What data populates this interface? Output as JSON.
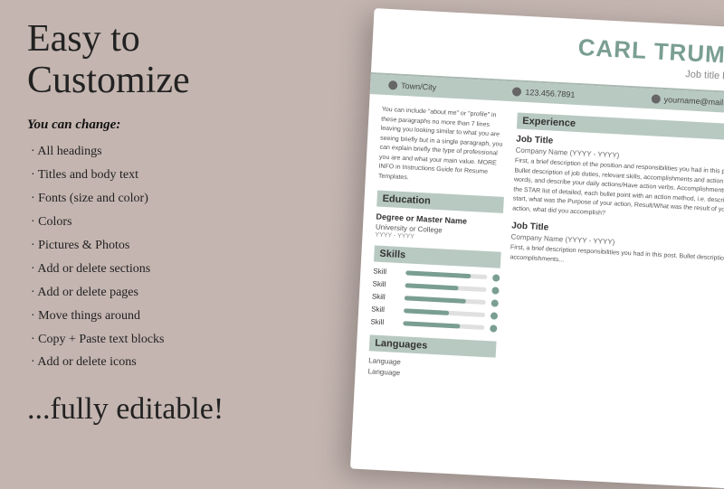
{
  "left": {
    "main_title": "Easy to Customize",
    "you_can_change_label": "You can change:",
    "features": [
      "All headings",
      "Titles and body text",
      "Fonts (size and color)",
      "Colors",
      "Pictures & Photos",
      "Add or delete sections",
      "Add or delete pages",
      "Move things around",
      "Copy + Paste text blocks",
      "Add or delete icons"
    ],
    "bottom_tagline": "...fully editable!"
  },
  "resume": {
    "name_part1": "CARL",
    "name_part2": "TRUMA",
    "job_title": "Job title here",
    "contact": {
      "location": "Town/City",
      "phone": "123.456.7891",
      "email": "yourname@mail.com"
    },
    "intro": "You can include \"about me\" or \"profile\" in these paragraphs no more than 7 lines leaving you looking similar to what you are seeing briefly but in a single paragraph, you can explain briefly the type of professional you are and what your main value. MORE INFO in Instructions Guide for Resume Templates.",
    "education": {
      "label": "Education",
      "degree": "Degree or Master Name",
      "school": "University or College",
      "year": "YYYY - YYYY"
    },
    "skills": {
      "label": "Skills",
      "items": [
        {
          "name": "Skill",
          "pct": 80
        },
        {
          "name": "Skill",
          "pct": 65
        },
        {
          "name": "Skill",
          "pct": 75
        },
        {
          "name": "Skill",
          "pct": 55
        },
        {
          "name": "Skill",
          "pct": 70
        }
      ]
    },
    "languages": {
      "label": "Languages",
      "items": [
        "Language",
        "Language"
      ]
    },
    "experience": {
      "label": "Experience",
      "jobs": [
        {
          "title": "Job Title",
          "company": "Company Name (YYYY - YYYY)",
          "desc": "First, a brief description of the position and responsibilities you had in this post. Bullet description of job duties, relevant skills, accomplishments and action words, and describe your daily actions/Have action verbs. Accomplishments (use the STAR list of detailed, each bullet point with an action method, i.e. describe - start, what was the Purpose of your action, Result/What was the result of your action, what did you accomplish?"
        },
        {
          "title": "Job Title",
          "company": "Company Name (YYYY - YYYY)",
          "desc": "First, a brief description responsibilities you had in this post. Bullet description accomplishments..."
        }
      ]
    }
  }
}
